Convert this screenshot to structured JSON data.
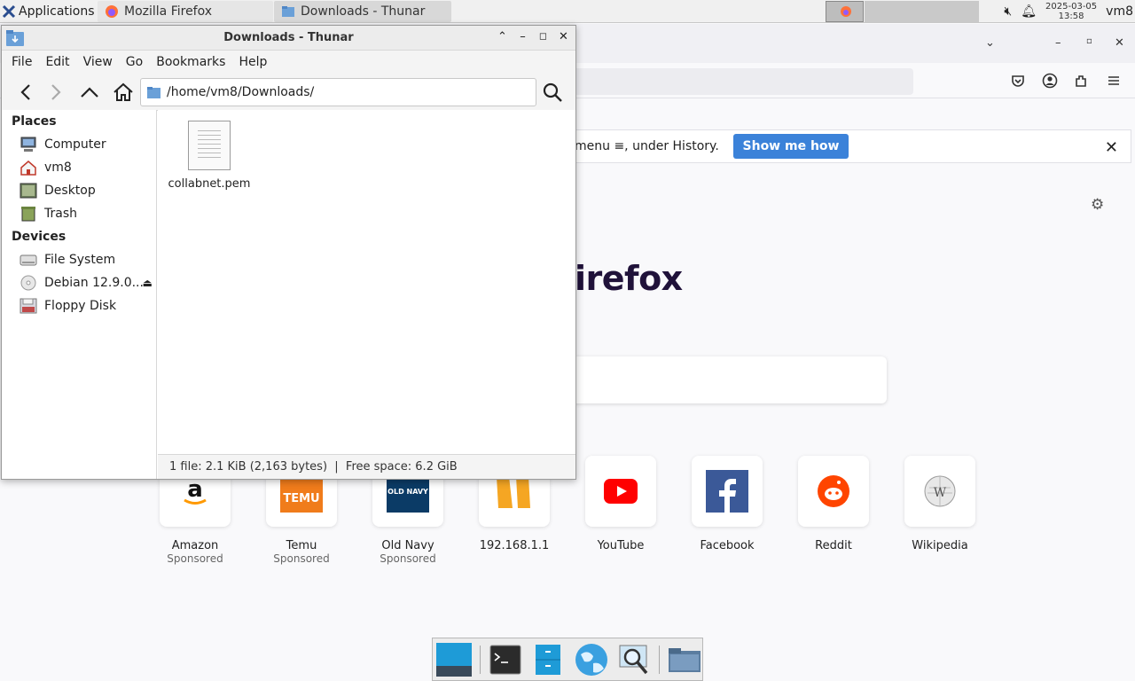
{
  "panel": {
    "applications_label": "Applications",
    "tasks": [
      {
        "label": "Mozilla Firefox",
        "icon": "firefox-icon"
      },
      {
        "label": "Downloads - Thunar",
        "icon": "folder-icon"
      }
    ],
    "clock_date": "2025-03-05",
    "clock_time": "13:58",
    "user": "vm8"
  },
  "firefox": {
    "notification_text": "menu ≡, under History.",
    "show_me_how": "Show me how",
    "logo_text": "irefox",
    "shortcuts": [
      {
        "label": "Amazon",
        "sub": "Sponsored",
        "icon": "amazon-icon"
      },
      {
        "label": "Temu",
        "sub": "Sponsored",
        "icon": "temu-icon"
      },
      {
        "label": "Old Navy",
        "sub": "Sponsored",
        "icon": "old-navy-icon",
        "badge": "OLD NAVY"
      },
      {
        "label": "192.168.1.1",
        "sub": "",
        "icon": "router-icon"
      },
      {
        "label": "YouTube",
        "sub": "",
        "icon": "youtube-icon"
      },
      {
        "label": "Facebook",
        "sub": "",
        "icon": "facebook-icon"
      },
      {
        "label": "Reddit",
        "sub": "",
        "icon": "reddit-icon"
      },
      {
        "label": "Wikipedia",
        "sub": "",
        "icon": "wikipedia-icon"
      }
    ],
    "temu_badge": "TEMU"
  },
  "thunar": {
    "title": "Downloads - Thunar",
    "menu": [
      "File",
      "Edit",
      "View",
      "Go",
      "Bookmarks",
      "Help"
    ],
    "location": "/home/vm8/Downloads/",
    "places_header": "Places",
    "places": [
      {
        "label": "Computer",
        "icon": "computer-icon"
      },
      {
        "label": "vm8",
        "icon": "home-icon"
      },
      {
        "label": "Desktop",
        "icon": "desktop-icon"
      },
      {
        "label": "Trash",
        "icon": "trash-icon"
      }
    ],
    "devices_header": "Devices",
    "devices": [
      {
        "label": "File System",
        "icon": "drive-icon"
      },
      {
        "label": "Debian 12.9.0...",
        "icon": "cdrom-icon"
      },
      {
        "label": "Floppy Disk",
        "icon": "floppy-icon"
      }
    ],
    "files": [
      {
        "name": "collabnet.pem",
        "icon": "text-file-icon"
      }
    ],
    "status": "1 file: 2.1 KiB (2,163 bytes)  |  Free space: 6.2 GiB"
  },
  "colors": {
    "accent": "#3b82d9",
    "ff_logo": "#20123a",
    "youtube": "#ff0000",
    "facebook": "#1877f2",
    "reddit": "#ff4500",
    "temu": "#f07c1b",
    "old_navy": "#0b3b66"
  }
}
